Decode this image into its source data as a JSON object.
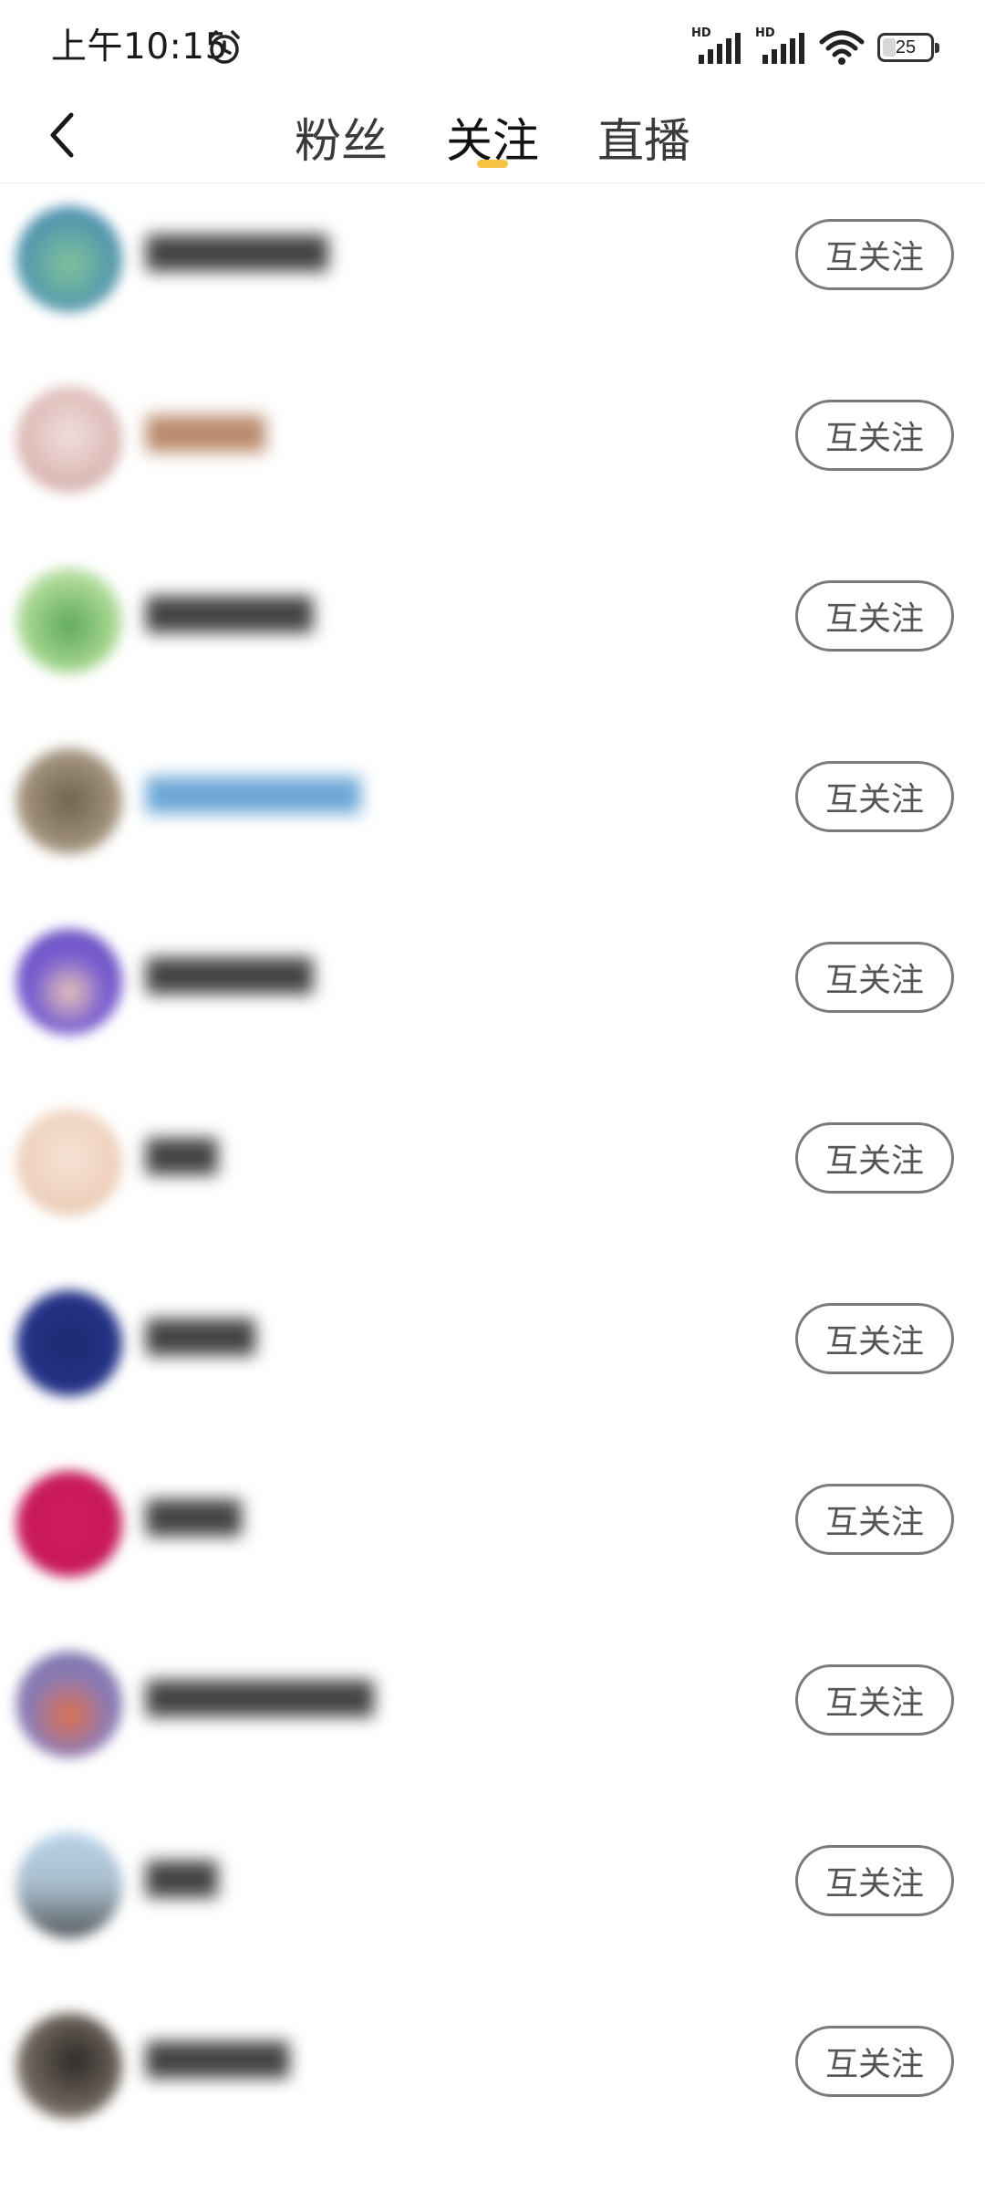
{
  "status_bar": {
    "time": "上午10:15",
    "battery_level": "25",
    "signal_labels": [
      "HD",
      "HD"
    ],
    "icons": [
      "alarm-icon",
      "signal-icon",
      "signal-icon",
      "wifi-icon",
      "battery-icon"
    ]
  },
  "header": {
    "back_icon": "chevron-left-icon",
    "tabs": [
      {
        "label": "粉丝",
        "active": false
      },
      {
        "label": "关注",
        "active": true
      },
      {
        "label": "直播",
        "active": false
      }
    ],
    "indicator_color": "#f5c242"
  },
  "list": {
    "items": [
      {
        "name": "████████",
        "follow_label": "互关注",
        "avatar_color": "#5fae8e"
      },
      {
        "name": "█████",
        "follow_label": "互关注",
        "avatar_color": "#e3c9c6"
      },
      {
        "name": "███████",
        "follow_label": "互关注",
        "avatar_color": "#7fbf6a"
      },
      {
        "name": "█████████",
        "follow_label": "互关注",
        "avatar_color": "#8a7c68"
      },
      {
        "name": "███████",
        "follow_label": "互关注",
        "avatar_color": "#6f5ac9"
      },
      {
        "name": "███",
        "follow_label": "互关注",
        "avatar_color": "#f0d7c4"
      },
      {
        "name": "█████",
        "follow_label": "互关注",
        "avatar_color": "#232f7a"
      },
      {
        "name": "████",
        "follow_label": "互关注",
        "avatar_color": "#d21e62"
      },
      {
        "name": "██████████",
        "follow_label": "互关注",
        "avatar_color": "#7a6fa8"
      },
      {
        "name": "███",
        "follow_label": "互关注",
        "avatar_color": "#8fa2b0"
      },
      {
        "name": "██████",
        "follow_label": "互关注",
        "avatar_color": "#5a5650"
      }
    ]
  }
}
